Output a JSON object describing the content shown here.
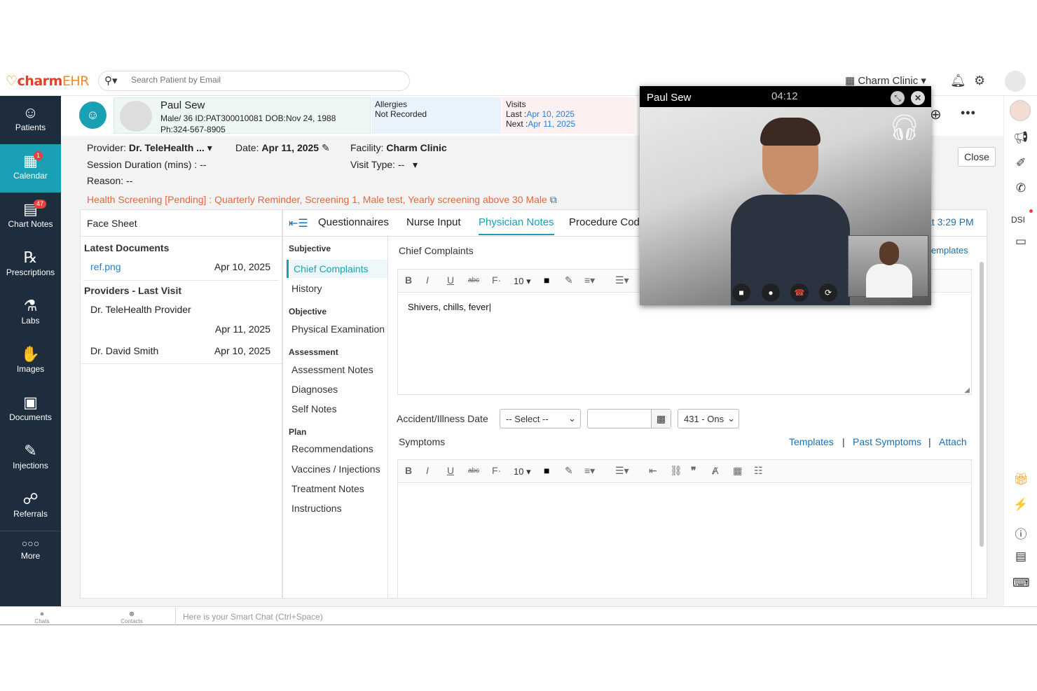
{
  "header": {
    "logo_brand": "charm",
    "logo_suffix": "EHR",
    "search_placeholder": "Search Patient by Email",
    "clinic_name": "Charm Clinic"
  },
  "sidebar": {
    "items": [
      {
        "label": "Patients",
        "icon": "patients-icon",
        "badge": ""
      },
      {
        "label": "Calendar",
        "icon": "calendar-icon",
        "badge": "1"
      },
      {
        "label": "Chart Notes",
        "icon": "chart-notes-icon",
        "badge": "47"
      },
      {
        "label": "Prescriptions",
        "icon": "prescriptions-icon",
        "badge": ""
      },
      {
        "label": "Labs",
        "icon": "labs-icon",
        "badge": ""
      },
      {
        "label": "Images",
        "icon": "images-icon",
        "badge": ""
      },
      {
        "label": "Documents",
        "icon": "documents-icon",
        "badge": ""
      },
      {
        "label": "Injections",
        "icon": "injections-icon",
        "badge": ""
      },
      {
        "label": "Referrals",
        "icon": "referrals-icon",
        "badge": ""
      }
    ],
    "more_label": "More"
  },
  "patient": {
    "name": "Paul Sew",
    "info_line": "Male/ 36  ID:PAT300010081  DOB:Nov 24, 1988",
    "phone": "Ph:324-567-8905",
    "allergies_label": "Allergies",
    "allergies_value": "Not Recorded",
    "visits_label": "Visits",
    "last_label": "Last  :",
    "last_value": "Apr 10, 2025",
    "next_label": "Next :",
    "next_value": "Apr 11, 2025"
  },
  "encounter": {
    "provider_label": "Provider:",
    "provider_value": "Dr. TeleHealth ...",
    "date_label": "Date:",
    "date_value": "Apr 11, 2025",
    "facility_label": "Facility:",
    "facility_value": "Charm Clinic",
    "session_label": "Session Duration (mins) :",
    "session_value": "--",
    "visit_type_label": "Visit Type:",
    "visit_type_value": "--",
    "reason_label": "Reason:",
    "reason_value": "--",
    "health_screening_label": "Health Screening [Pending] :",
    "health_screening_value": "Quarterly Reminder, Screening 1, Male test, Yearly screening above 30 Male",
    "close_label": "Close"
  },
  "face_sheet": {
    "title": "Face Sheet",
    "latest_documents_label": "Latest Documents",
    "documents": [
      {
        "name": "ref.png",
        "date": "Apr 10, 2025"
      }
    ],
    "providers_label": "Providers  -  Last Visit",
    "providers": [
      {
        "name": "Dr. TeleHealth Provider",
        "date": "Apr 11, 2025"
      },
      {
        "name": "Dr. David Smith",
        "date": "Apr 10, 2025"
      }
    ]
  },
  "tabs": [
    "Questionnaires",
    "Nurse Input",
    "Physician Notes",
    "Procedure Cod"
  ],
  "tab_time_fragment": "at 3:29 PM",
  "sections": {
    "subjective": "Subjective",
    "chief_complaints": "Chief Complaints",
    "history": "History",
    "objective": "Objective",
    "physical_exam": "Physical Examination",
    "assessment": "Assessment",
    "assessment_notes": "Assessment Notes",
    "diagnoses": "Diagnoses",
    "self_notes": "Self Notes",
    "plan": "Plan",
    "recommendations": "Recommendations",
    "vaccines": "Vaccines / Injections",
    "treatment_notes": "Treatment Notes",
    "instructions": "Instructions"
  },
  "content": {
    "chief_complaints_title": "Chief Complaints",
    "templates_fragment": "emplates",
    "font_size": "10",
    "chief_complaints_text": "Shivers, chills, fever",
    "accident_label": "Accident/Illness Date",
    "select_placeholder": "-- Select --",
    "onset_value": "431 - Ons",
    "symptoms_label": "Symptoms",
    "templates_link": "Templates",
    "past_symptoms_link": "Past Symptoms",
    "attach_link": "Attach",
    "sep": "|"
  },
  "bottombar": {
    "chats_label": "Chats",
    "contacts_label": "Contacts",
    "smart_chat_placeholder": "Here is your Smart Chat (Ctrl+Space)"
  },
  "video_call": {
    "name": "Paul Sew",
    "timer": "04:12"
  },
  "rail": {
    "dsi_label": "DSI"
  },
  "colors": {
    "accent": "#1aa0b4",
    "sidebar": "#1e2d3d",
    "link": "#1a6fb4",
    "alert": "#e8643c"
  }
}
